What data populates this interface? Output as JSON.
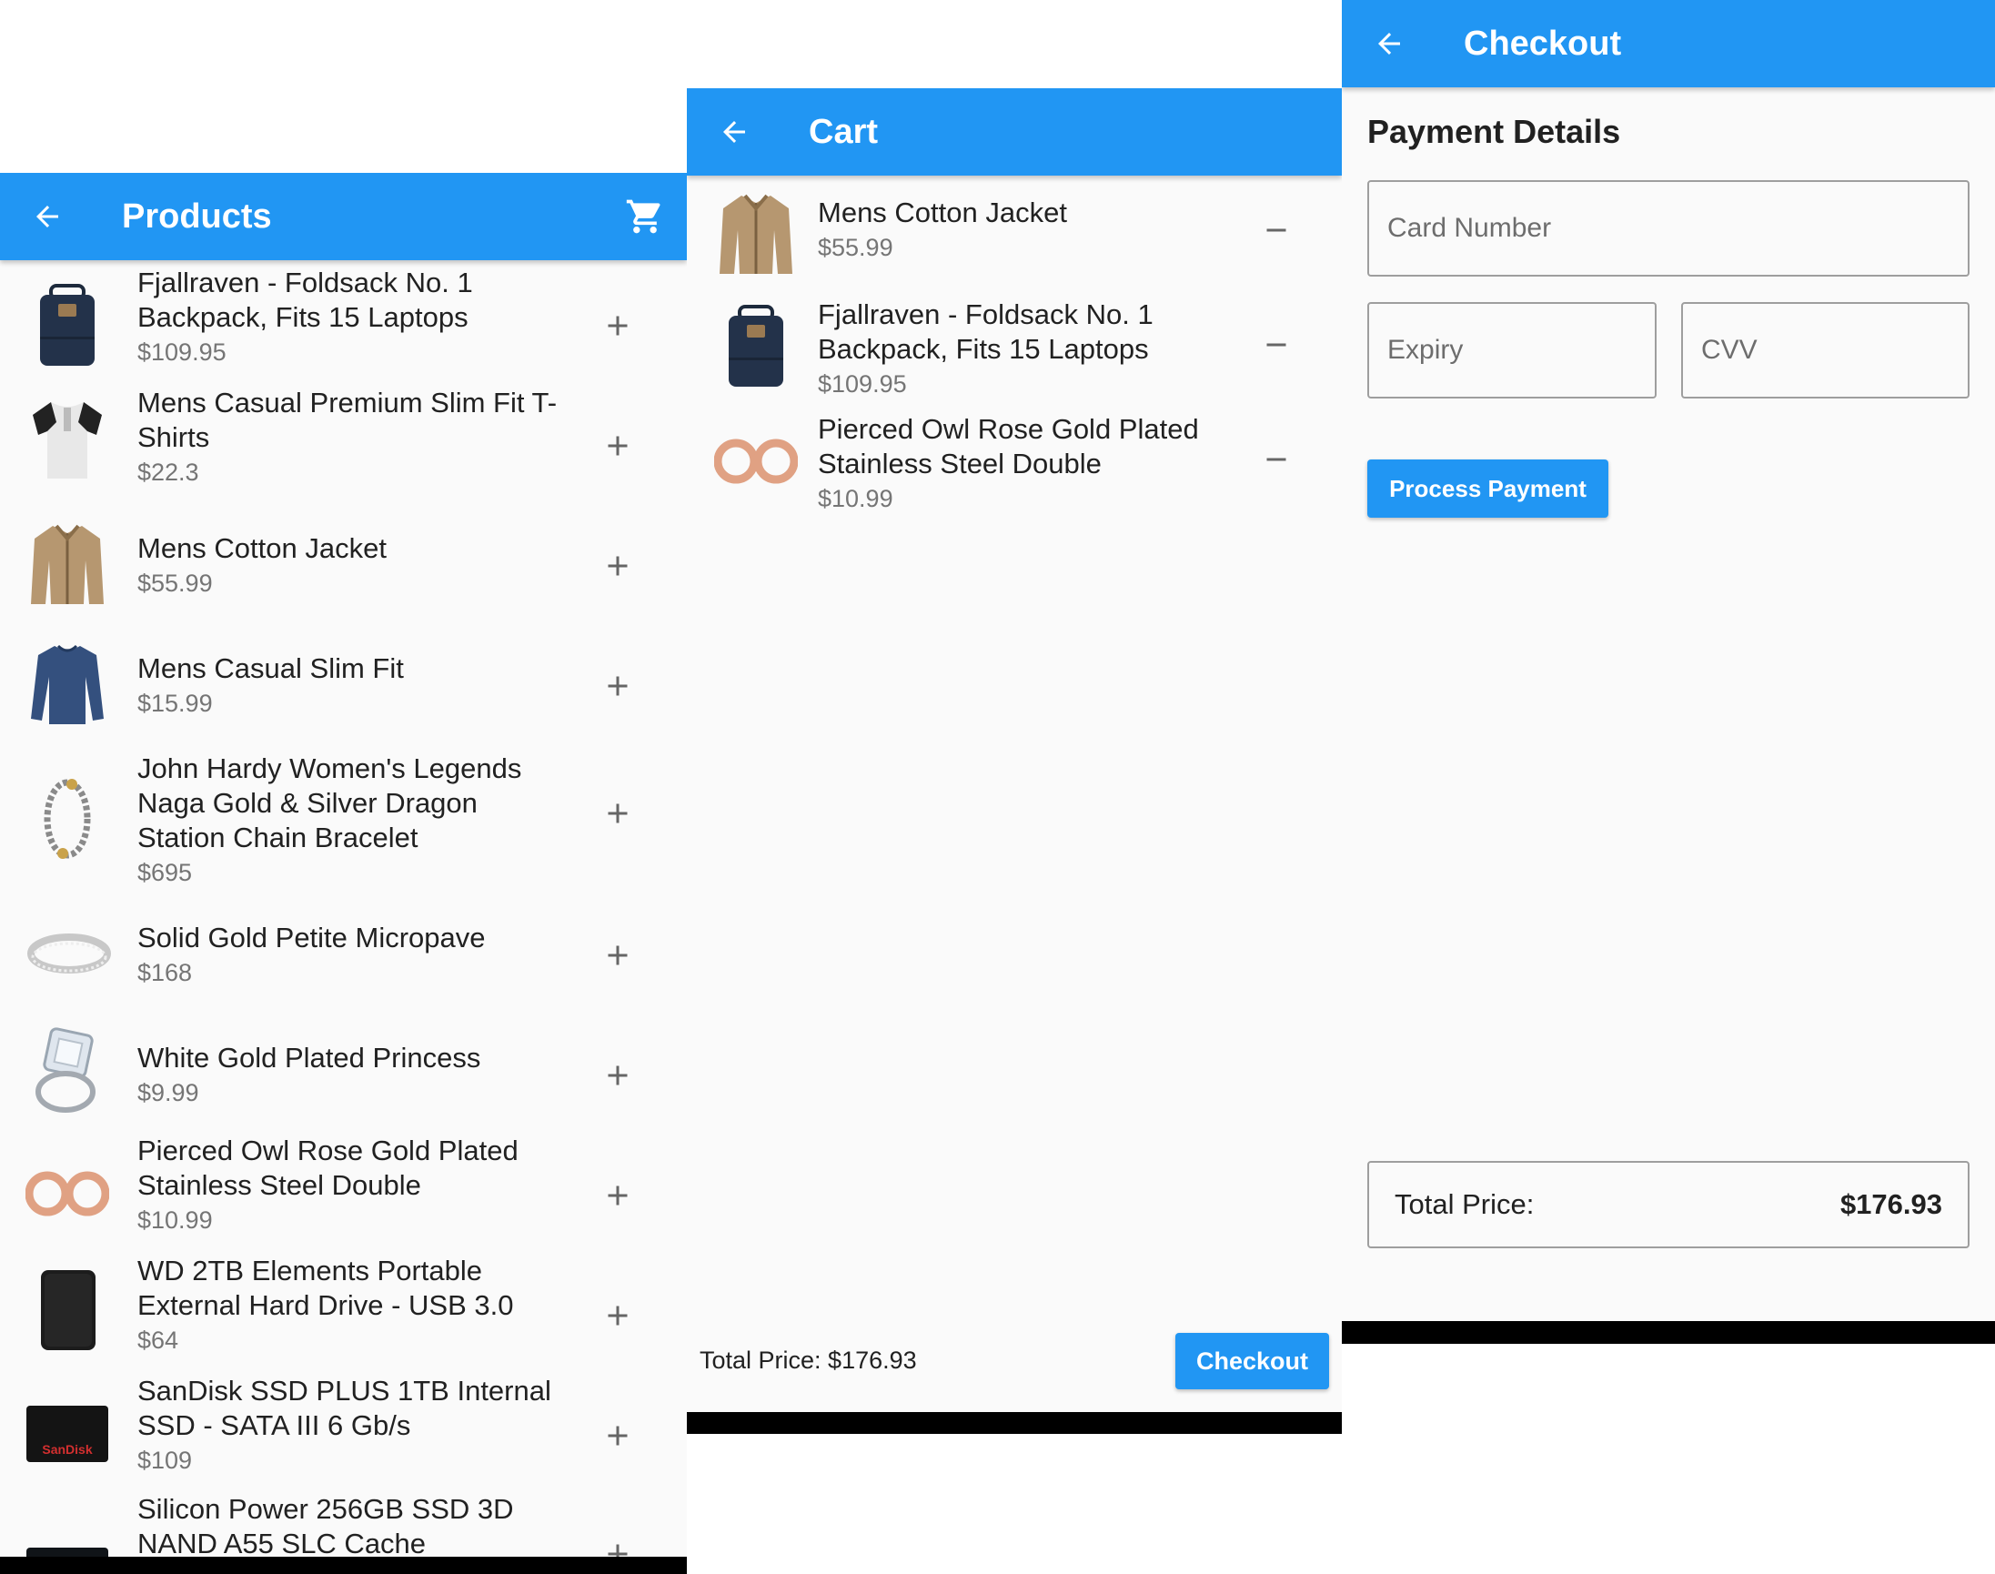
{
  "colors": {
    "primary": "#2196f3",
    "background": "#fafafa",
    "price_text": "#757575"
  },
  "products_screen": {
    "title": "Products",
    "back_icon": "arrow-left-icon",
    "cart_icon": "shopping-cart-icon",
    "items": [
      {
        "title": "Fjallraven - Foldsack No. 1 Backpack, Fits 15 Laptops",
        "price": "$109.95",
        "image": "backpack-image",
        "action_icon": "plus-icon"
      },
      {
        "title": "Mens Casual Premium Slim Fit T-Shirts",
        "price": "$22.3",
        "image": "tshirt-image",
        "action_icon": "plus-icon"
      },
      {
        "title": "Mens Cotton Jacket",
        "price": "$55.99",
        "image": "jacket-image",
        "action_icon": "plus-icon"
      },
      {
        "title": "Mens Casual Slim Fit",
        "price": "$15.99",
        "image": "longsleeve-shirt-image",
        "action_icon": "plus-icon"
      },
      {
        "title": "John Hardy Women's Legends Naga Gold & Silver Dragon Station Chain Bracelet",
        "price": "$695",
        "image": "bracelet-image",
        "action_icon": "plus-icon"
      },
      {
        "title": "Solid Gold Petite Micropave",
        "price": "$168",
        "image": "ring-band-image",
        "action_icon": "plus-icon"
      },
      {
        "title": "White Gold Plated Princess",
        "price": "$9.99",
        "image": "diamond-ring-image",
        "action_icon": "plus-icon"
      },
      {
        "title": "Pierced Owl Rose Gold Plated Stainless Steel Double",
        "price": "$10.99",
        "image": "rose-gold-plugs-image",
        "action_icon": "plus-icon"
      },
      {
        "title": "WD 2TB Elements Portable External Hard Drive - USB 3.0",
        "price": "$64",
        "image": "hard-drive-image",
        "action_icon": "plus-icon"
      },
      {
        "title": "SanDisk SSD PLUS 1TB Internal SSD - SATA III 6 Gb/s",
        "price": "$109",
        "image": "sandisk-ssd-image",
        "image_text": "SanDisk",
        "action_icon": "plus-icon"
      },
      {
        "title": "Silicon Power 256GB SSD 3D NAND A55 SLC Cache",
        "price": "",
        "image": "silicon-power-ssd-image",
        "action_icon": "plus-icon"
      }
    ]
  },
  "cart_screen": {
    "title": "Cart",
    "back_icon": "arrow-left-icon",
    "items": [
      {
        "title": "Mens Cotton Jacket",
        "price": "$55.99",
        "image": "jacket-image",
        "action_icon": "minus-icon"
      },
      {
        "title": "Fjallraven - Foldsack No. 1 Backpack, Fits 15 Laptops",
        "price": "$109.95",
        "image": "backpack-image",
        "action_icon": "minus-icon"
      },
      {
        "title": "Pierced Owl Rose Gold Plated Stainless Steel Double",
        "price": "$10.99",
        "image": "rose-gold-plugs-image",
        "action_icon": "minus-icon"
      }
    ],
    "total_label": "Total Price: $176.93",
    "checkout_button": "Checkout"
  },
  "checkout_screen": {
    "title": "Checkout",
    "back_icon": "arrow-left-icon",
    "section_title": "Payment Details",
    "card_number_placeholder": "Card Number",
    "expiry_placeholder": "Expiry",
    "cvv_placeholder": "CVV",
    "process_button": "Process Payment",
    "total_label": "Total Price:",
    "total_value": "$176.93"
  }
}
